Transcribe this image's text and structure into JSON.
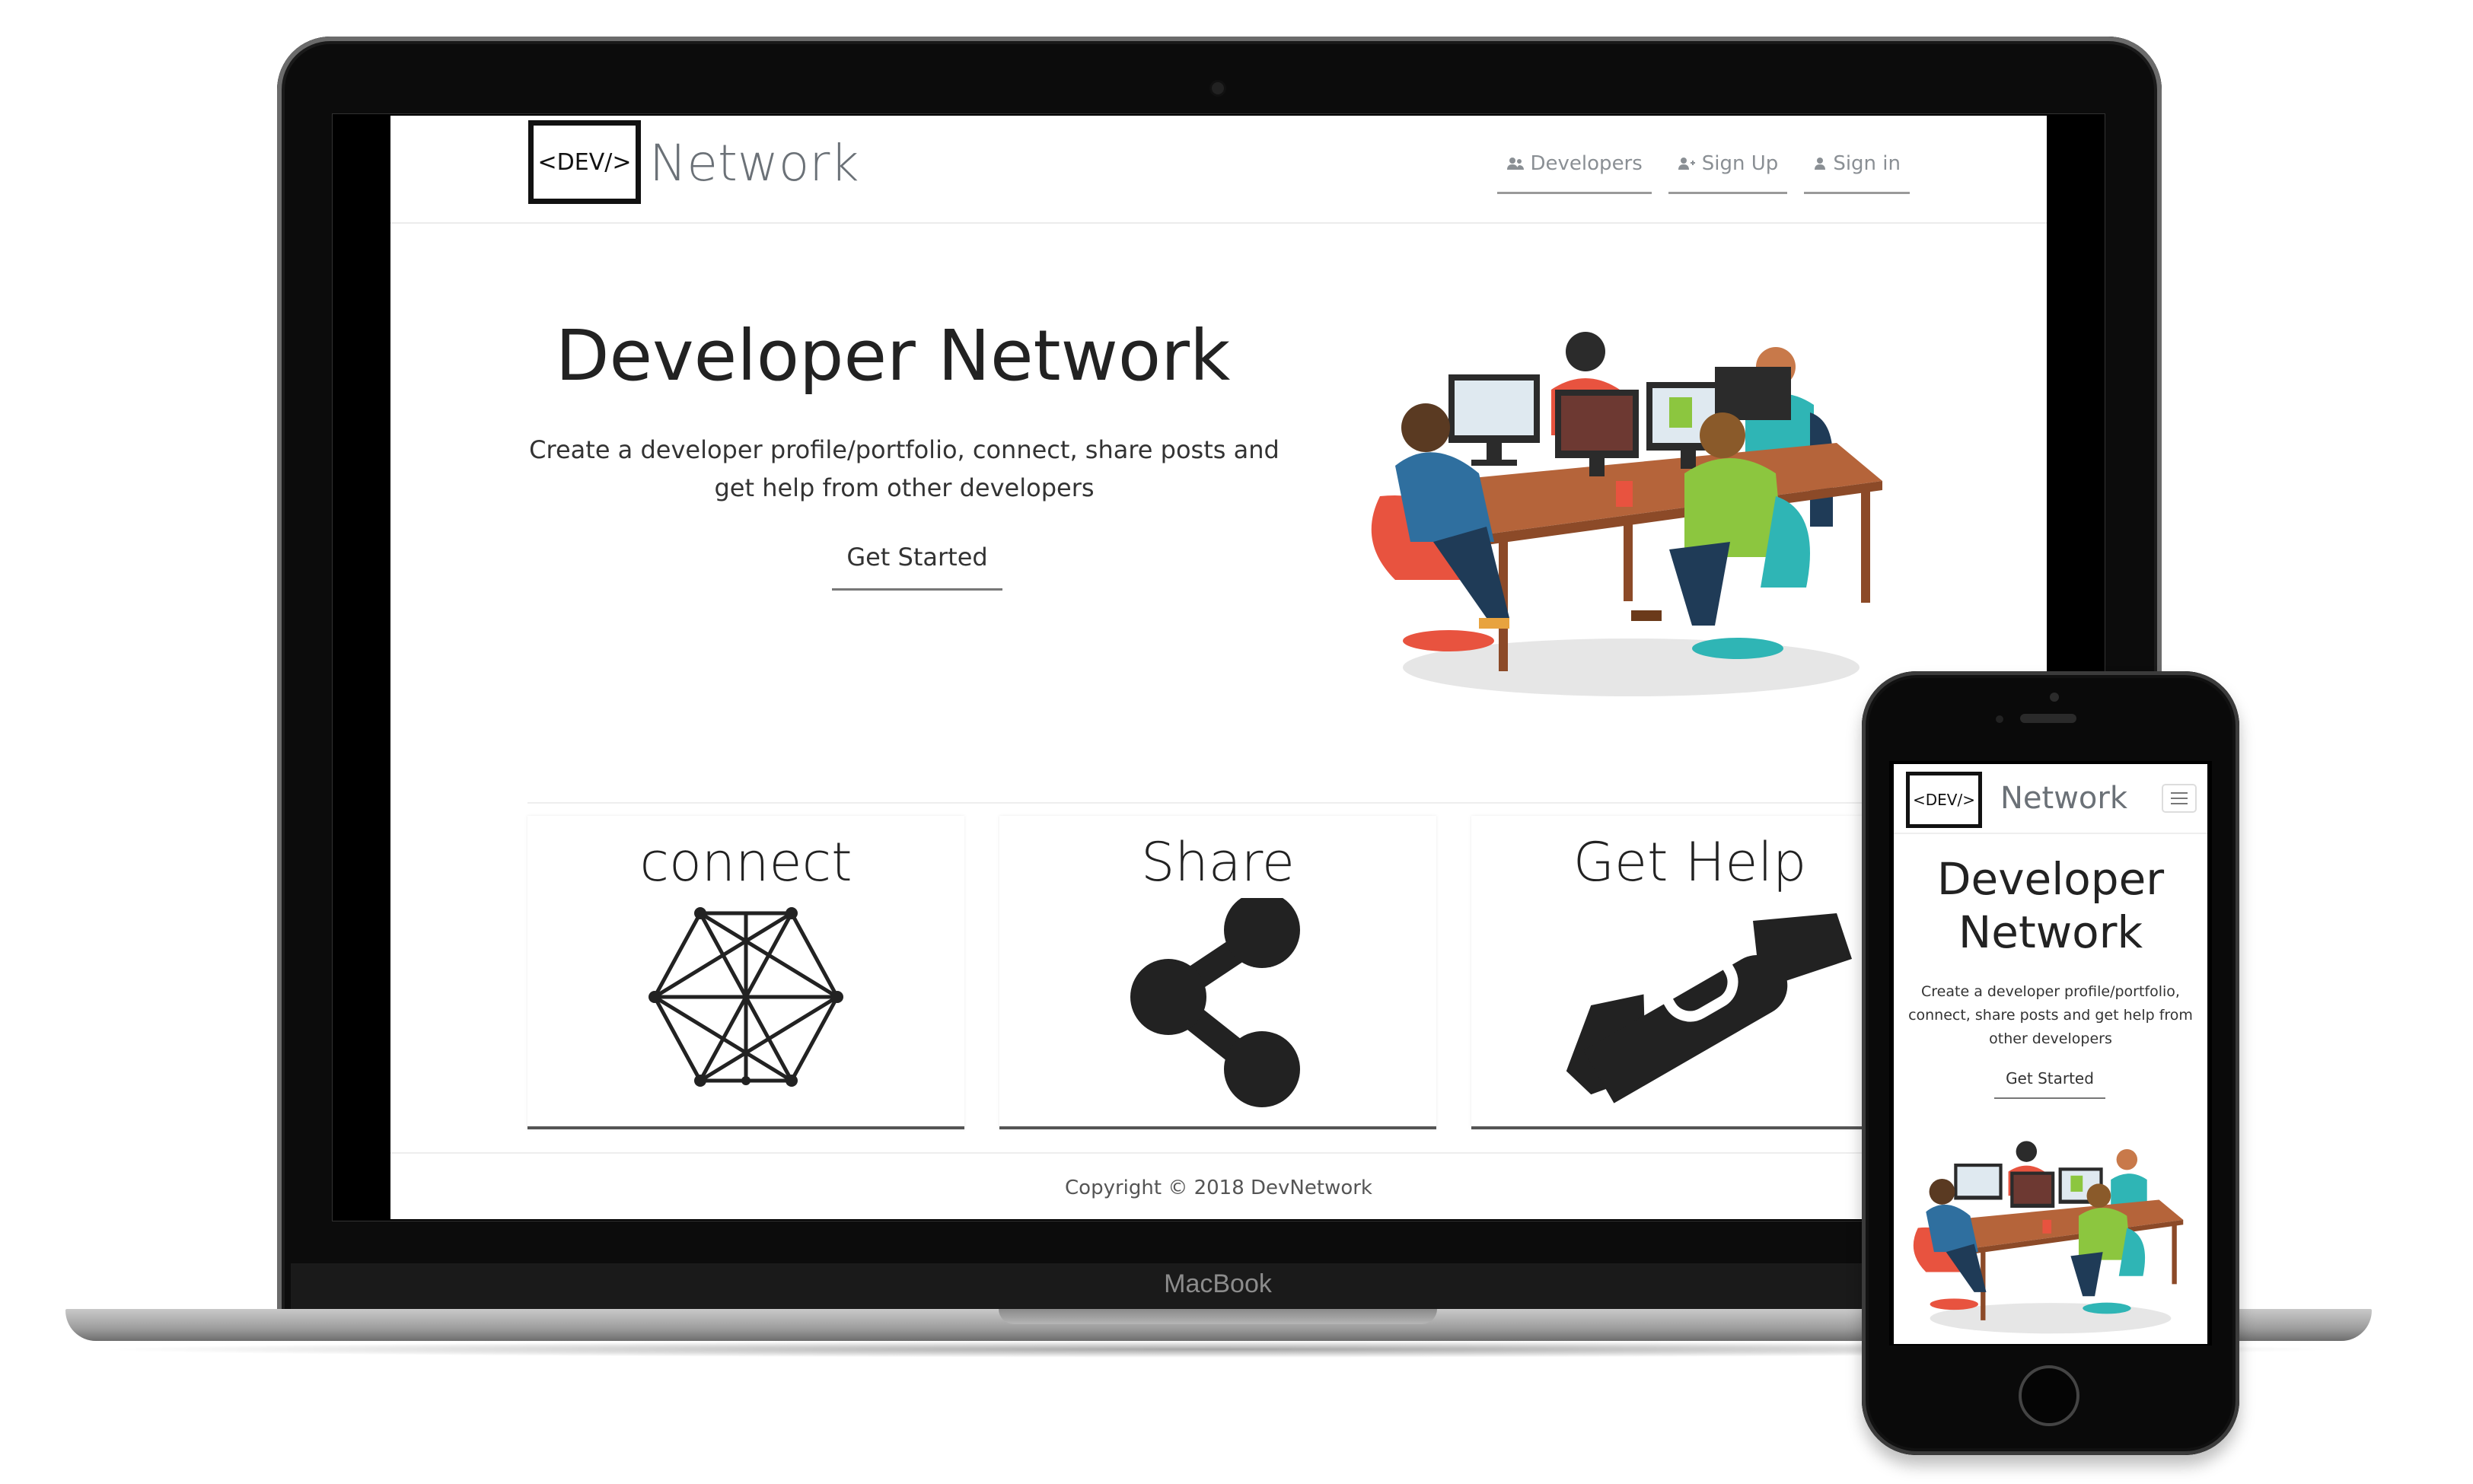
{
  "laptop": {
    "brand": "MacBook"
  },
  "site": {
    "logo_box": "<DEV/>",
    "logo_text": "Network",
    "nav": [
      {
        "label": "Developers",
        "icon": "users-icon"
      },
      {
        "label": "Sign Up",
        "icon": "user-plus-icon"
      },
      {
        "label": "Sign in",
        "icon": "user-icon"
      }
    ],
    "hero": {
      "title": "Developer Network",
      "subtitle": "Create a developer profile/portfolio, connect, share posts and get help from other developers",
      "cta": "Get Started"
    },
    "cards": [
      {
        "title": "connect",
        "icon": "network-hexagon-icon"
      },
      {
        "title": "Share",
        "icon": "share-icon"
      },
      {
        "title": "Get Help",
        "icon": "handshake-icon"
      }
    ],
    "footer": "Copyright © 2018 DevNetwork"
  },
  "mobile": {
    "logo_box": "<DEV/>",
    "logo_text": "Network",
    "hero_title": "Developer Network",
    "hero_subtitle": "Create a developer profile/portfolio, connect, share posts and get help from other developers",
    "cta": "Get Started",
    "menu_icon": "hamburger-menu-icon"
  },
  "colors": {
    "text_dark": "#222222",
    "nav_gray": "#8a8f94",
    "logo_gray": "#6b7177",
    "shirt_red": "#e8533f",
    "shirt_teal": "#2fb5b5",
    "shirt_green": "#8cc63f",
    "desk_brown": "#b5643a"
  }
}
